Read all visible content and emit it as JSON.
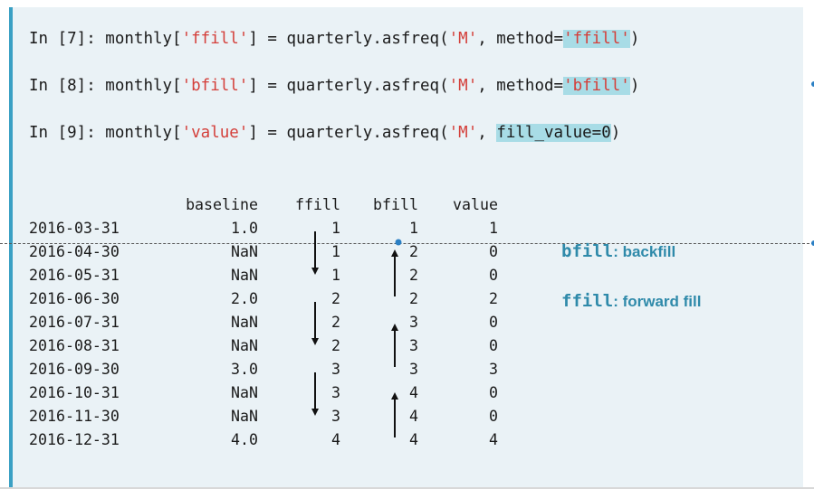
{
  "code": [
    {
      "prompt": "In [7]: ",
      "pre": "monthly[",
      "key": "'ffill'",
      "mid": "] = quarterly.asfreq(",
      "freq": "'M'",
      "sep": ", method=",
      "arg": "'ffill'",
      "end": ")"
    },
    {
      "prompt": "In [8]: ",
      "pre": "monthly[",
      "key": "'bfill'",
      "mid": "] = quarterly.asfreq(",
      "freq": "'M'",
      "sep": ", method=",
      "arg": "'bfill'",
      "end": ")"
    },
    {
      "prompt": "In [9]: ",
      "pre": "monthly[",
      "key": "'value'",
      "mid": "] = quarterly.asfreq(",
      "freq": "'M'",
      "sep": ", ",
      "arg": "fill_value=0",
      "end": ")"
    }
  ],
  "table": {
    "headers": [
      "baseline",
      "ffill",
      "bfill",
      "value"
    ],
    "rows": [
      {
        "date": "2016-03-31",
        "baseline": "1.0",
        "ffill": "1",
        "bfill": "1",
        "value": "1"
      },
      {
        "date": "2016-04-30",
        "baseline": "NaN",
        "ffill": "1",
        "bfill": "2",
        "value": "0"
      },
      {
        "date": "2016-05-31",
        "baseline": "NaN",
        "ffill": "1",
        "bfill": "2",
        "value": "0"
      },
      {
        "date": "2016-06-30",
        "baseline": "2.0",
        "ffill": "2",
        "bfill": "2",
        "value": "2"
      },
      {
        "date": "2016-07-31",
        "baseline": "NaN",
        "ffill": "2",
        "bfill": "3",
        "value": "0"
      },
      {
        "date": "2016-08-31",
        "baseline": "NaN",
        "ffill": "2",
        "bfill": "3",
        "value": "0"
      },
      {
        "date": "2016-09-30",
        "baseline": "3.0",
        "ffill": "3",
        "bfill": "3",
        "value": "3"
      },
      {
        "date": "2016-10-31",
        "baseline": "NaN",
        "ffill": "3",
        "bfill": "4",
        "value": "0"
      },
      {
        "date": "2016-11-30",
        "baseline": "NaN",
        "ffill": "3",
        "bfill": "4",
        "value": "0"
      },
      {
        "date": "2016-12-31",
        "baseline": "4.0",
        "ffill": "4",
        "bfill": "4",
        "value": "4"
      }
    ]
  },
  "annotations": {
    "bfill_term": "bfill",
    "bfill_desc": ": backfill",
    "ffill_term": "ffill",
    "ffill_desc": ": forward fill"
  },
  "colors": {
    "accent": "#3aa0c4",
    "string": "#d43f3a",
    "highlight": "#a8dce6",
    "annotation": "#2f8aaa",
    "panel": "#eaf2f6"
  }
}
